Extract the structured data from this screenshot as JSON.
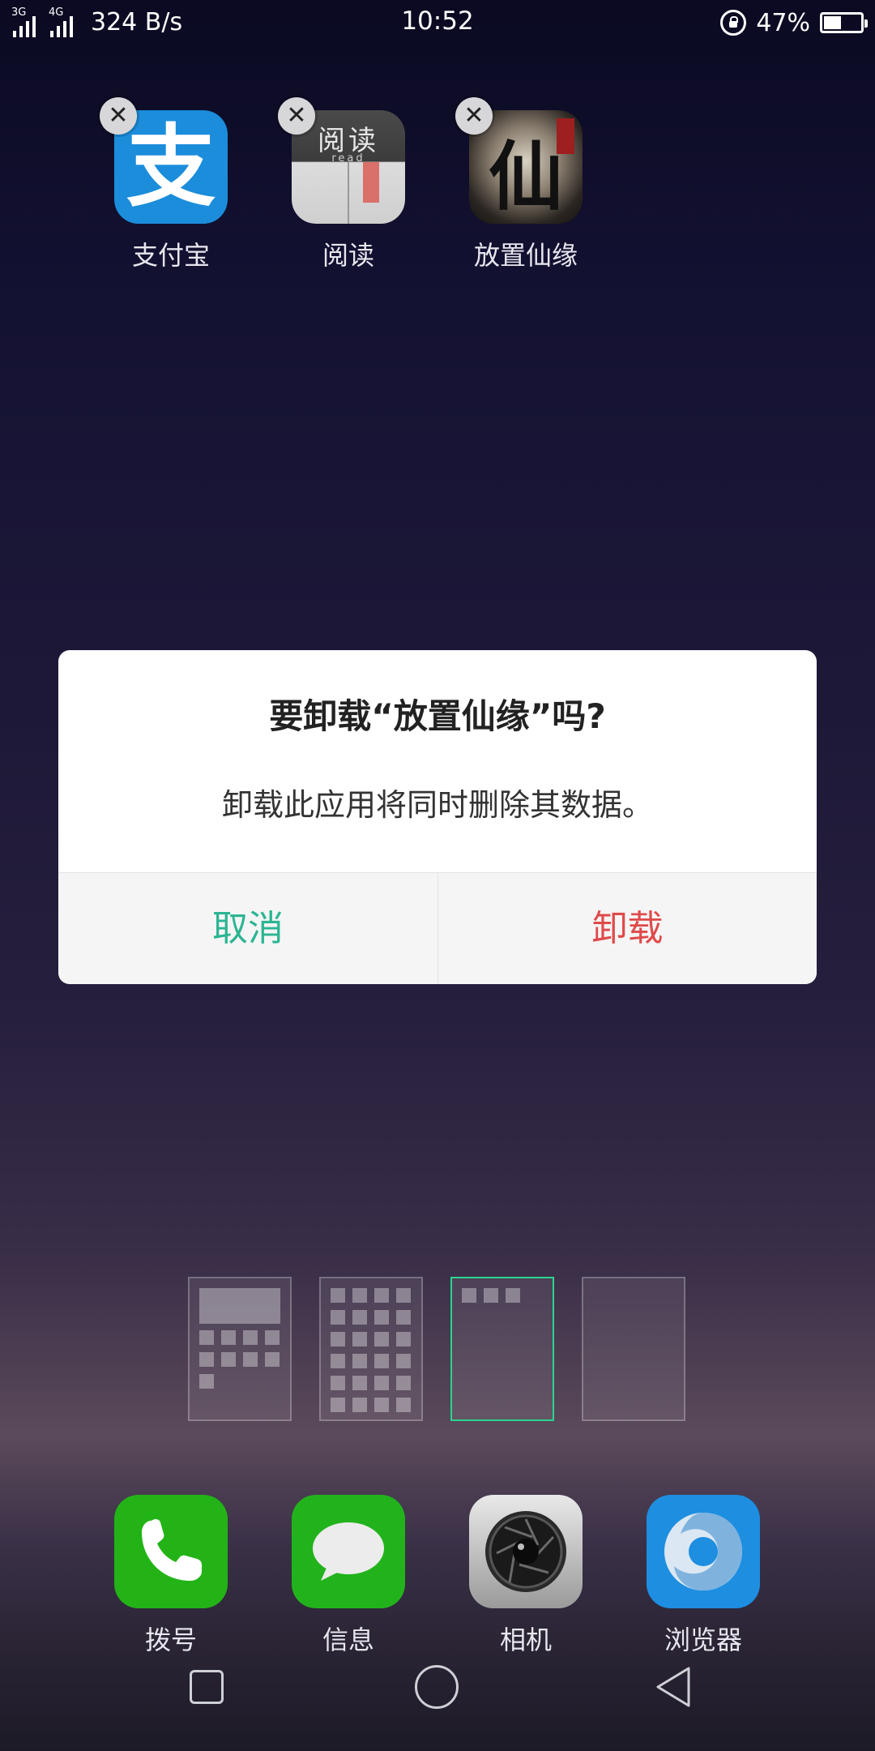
{
  "status_bar": {
    "network_1": "3G",
    "network_2": "4G",
    "speed": "324 B/s",
    "time": "10:52",
    "battery_percent": "47%",
    "battery_level": 0.47
  },
  "home_apps": [
    {
      "label": "支付宝",
      "icon": "alipay-icon",
      "glyph": "支"
    },
    {
      "label": "阅读",
      "icon": "reader-icon",
      "glyph": "阅读",
      "sub": "read"
    },
    {
      "label": "放置仙缘",
      "icon": "game-icon",
      "glyph": "仙"
    }
  ],
  "remove_badge": "✕",
  "dialog": {
    "title": "要卸载“放置仙缘”吗?",
    "message": "卸载此应用将同时删除其数据。",
    "cancel_label": "取消",
    "confirm_label": "卸载",
    "cancel_color": "#2bb592",
    "confirm_color": "#e04a4a"
  },
  "pages": [
    {
      "name": "page-1",
      "active": false
    },
    {
      "name": "page-2",
      "active": false
    },
    {
      "name": "page-3",
      "active": true
    },
    {
      "name": "page-4",
      "active": false
    }
  ],
  "dock": [
    {
      "label": "拨号",
      "icon": "phone-icon"
    },
    {
      "label": "信息",
      "icon": "message-icon"
    },
    {
      "label": "相机",
      "icon": "camera-icon"
    },
    {
      "label": "浏览器",
      "icon": "browser-icon"
    }
  ],
  "nav": {
    "recent": "recent-apps-icon",
    "home": "home-icon",
    "back": "back-icon"
  }
}
